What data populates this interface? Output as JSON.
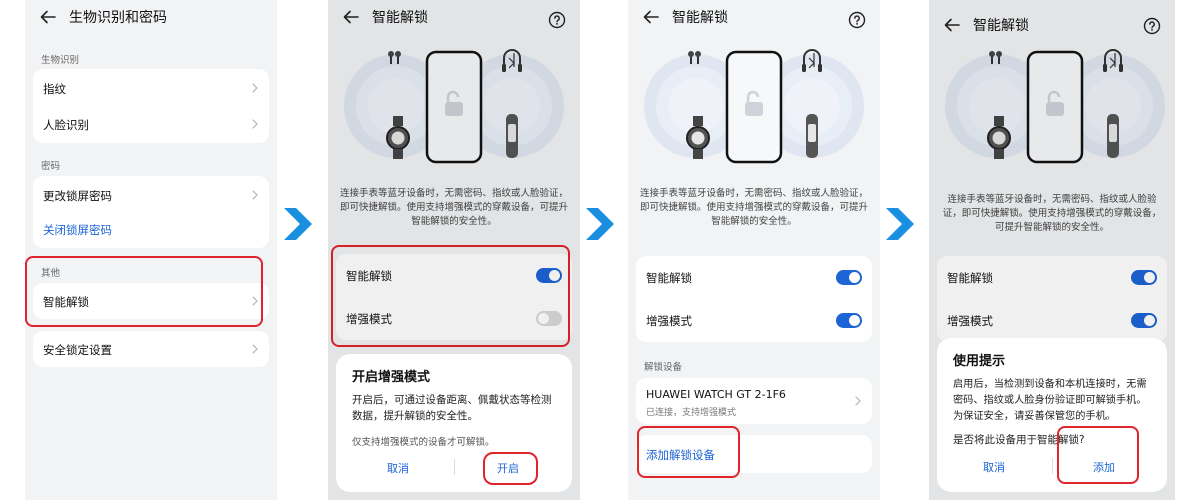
{
  "screen1": {
    "title": "生物识别和密码",
    "biometrics_section": "生物识别",
    "fingerprint": "指纹",
    "face": "人脸识别",
    "password_section": "密码",
    "change_password": "更改锁屏密码",
    "disable_password": "关闭锁屏密码",
    "other_section": "其他",
    "smart_unlock": "智能解锁",
    "security_lock": "安全锁定设置"
  },
  "screen2": {
    "title": "智能解锁",
    "description": "连接手表等蓝牙设备时，无需密码、指纹或人脸验证，即可快捷解锁。使用支持增强模式的穿戴设备，可提升智能解锁的安全性。",
    "smart_unlock": "智能解锁",
    "enhanced_mode": "增强模式",
    "dialog_title": "开启增强模式",
    "dialog_body": "开启后，可通过设备距离、佩戴状态等检测数据，提升解锁的安全性。",
    "dialog_note": "仅支持增强模式的设备才可解锁。",
    "cancel": "取消",
    "confirm": "开启"
  },
  "screen3": {
    "title": "智能解锁",
    "description": "连接手表等蓝牙设备时，无需密码、指纹或人脸验证，即可快捷解锁。使用支持增强模式的穿戴设备，可提升智能解锁的安全性。",
    "smart_unlock": "智能解锁",
    "enhanced_mode": "增强模式",
    "devices_section": "解锁设备",
    "device_name": "HUAWEI WATCH GT 2-1F6",
    "device_status": "已连接，支持增强模式",
    "add_device": "添加解锁设备"
  },
  "screen4": {
    "title": "智能解锁",
    "description": "连接手表等蓝牙设备时，无需密码、指纹或人脸验证，即可快捷解锁。使用支持增强模式的穿戴设备，可提升智能解锁的安全性。",
    "smart_unlock": "智能解锁",
    "enhanced_mode": "增强模式",
    "dialog_title": "使用提示",
    "dialog_body": "启用后，当检测到设备和本机连接时，无需密码、指纹或人脸身份验证即可解锁手机。为保证安全，请妥善保管您的手机。",
    "dialog_question": "是否将此设备用于智能解锁?",
    "cancel": "取消",
    "confirm": "添加"
  },
  "toggles": {
    "s2_smart_unlock": true,
    "s2_enhanced": false,
    "s3_smart_unlock": true,
    "s3_enhanced": true,
    "s4_smart_unlock": true,
    "s4_enhanced": true
  },
  "colors": {
    "accent": "#1d64d6",
    "highlight": "#e0242b",
    "step_chevron": "#1a8fe0"
  },
  "icons": [
    "back-arrow-icon",
    "help-icon",
    "chevron-right-icon",
    "step-chevron-icon",
    "earbuds-icon",
    "bluetooth-headset-icon",
    "watch-icon",
    "band-icon",
    "phone-unlock-icon"
  ]
}
